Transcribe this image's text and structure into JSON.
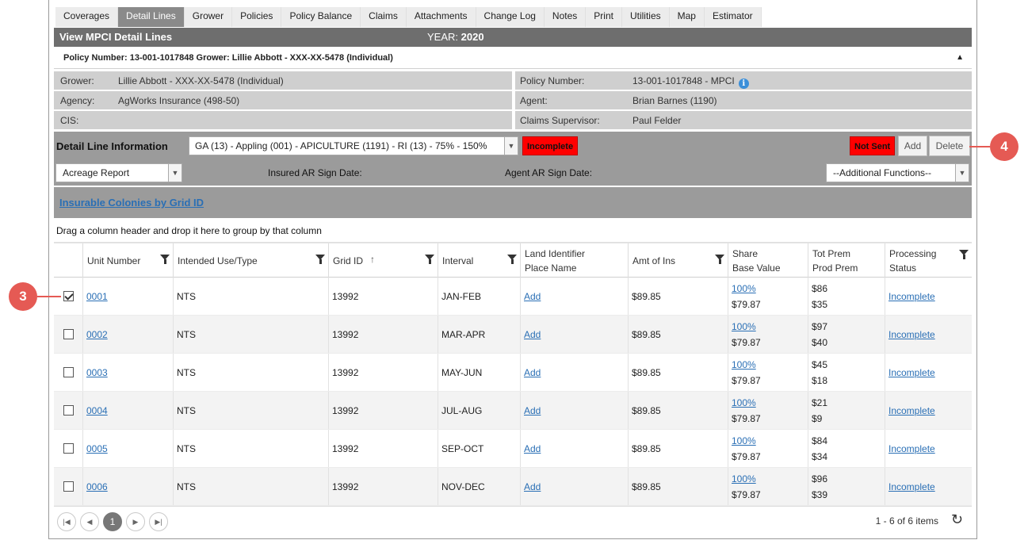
{
  "tabs": [
    {
      "label": "Coverages",
      "active": false
    },
    {
      "label": "Detail Lines",
      "active": true
    },
    {
      "label": "Grower",
      "active": false
    },
    {
      "label": "Policies",
      "active": false
    },
    {
      "label": "Policy Balance",
      "active": false
    },
    {
      "label": "Claims",
      "active": false
    },
    {
      "label": "Attachments",
      "active": false
    },
    {
      "label": "Change Log",
      "active": false
    },
    {
      "label": "Notes",
      "active": false
    },
    {
      "label": "Print",
      "active": false
    },
    {
      "label": "Utilities",
      "active": false
    },
    {
      "label": "Map",
      "active": false
    },
    {
      "label": "Estimator",
      "active": false
    }
  ],
  "title_bar": {
    "title": "View MPCI Detail Lines",
    "year_label": "YEAR:",
    "year": "2020"
  },
  "policy_header": {
    "text": "Policy Number: 13-001-1017848 Grower: Lillie Abbott - XXX-XX-5478 (Individual)",
    "collapse_glyph": "▲"
  },
  "info": {
    "grower_label": "Grower:",
    "grower": "Lillie Abbott - XXX-XX-5478 (Individual)",
    "agency_label": "Agency:",
    "agency": "AgWorks Insurance (498-50)",
    "cis_label": "CIS:",
    "cis": "",
    "policy_number_label": "Policy Number:",
    "policy_number": "13-001-1017848 - MPCI",
    "agent_label": "Agent:",
    "agent": "Brian Barnes (1190)",
    "claims_supervisor_label": "Claims Supervisor:",
    "claims_supervisor": "Paul Felder"
  },
  "detail_line": {
    "title": "Detail Line Information",
    "selected": "GA (13) - Appling (001) - APICULTURE (1191) - RI (13) - 75% - 150%",
    "status": "Incomplete",
    "send_status": "Not Sent",
    "add_label": "Add",
    "delete_label": "Delete",
    "report_type": "Acreage Report",
    "insured_sign_label": "Insured AR Sign Date:",
    "agent_sign_label": "Agent AR Sign Date:",
    "additional_functions": "--Additional Functions--"
  },
  "colonies_link": "Insurable Colonies by Grid ID",
  "group_hint": "Drag a column header and drop it here to group by that column",
  "columns": {
    "unit_number": "Unit Number",
    "intended_use": "Intended Use/Type",
    "grid_id": "Grid ID",
    "interval": "Interval",
    "land_id_1": "Land Identifier",
    "land_id_2": "Place Name",
    "amt_of_ins": "Amt of Ins",
    "share_1": "Share",
    "share_2": "Base Value",
    "prem_1": "Tot Prem",
    "prem_2": "Prod Prem",
    "status_1": "Processing",
    "status_2": "Status"
  },
  "rows": [
    {
      "checked": true,
      "unit": "0001",
      "use": "NTS",
      "grid": "13992",
      "interval": "JAN-FEB",
      "land": "Add",
      "amt": "$89.85",
      "share": "100%",
      "base": "$79.87",
      "tot_prem": "$86",
      "prod_prem": "$35",
      "status": "Incomplete"
    },
    {
      "checked": false,
      "unit": "0002",
      "use": "NTS",
      "grid": "13992",
      "interval": "MAR-APR",
      "land": "Add",
      "amt": "$89.85",
      "share": "100%",
      "base": "$79.87",
      "tot_prem": "$97",
      "prod_prem": "$40",
      "status": "Incomplete"
    },
    {
      "checked": false,
      "unit": "0003",
      "use": "NTS",
      "grid": "13992",
      "interval": "MAY-JUN",
      "land": "Add",
      "amt": "$89.85",
      "share": "100%",
      "base": "$79.87",
      "tot_prem": "$45",
      "prod_prem": "$18",
      "status": "Incomplete"
    },
    {
      "checked": false,
      "unit": "0004",
      "use": "NTS",
      "grid": "13992",
      "interval": "JUL-AUG",
      "land": "Add",
      "amt": "$89.85",
      "share": "100%",
      "base": "$79.87",
      "tot_prem": "$21",
      "prod_prem": "$9",
      "status": "Incomplete"
    },
    {
      "checked": false,
      "unit": "0005",
      "use": "NTS",
      "grid": "13992",
      "interval": "SEP-OCT",
      "land": "Add",
      "amt": "$89.85",
      "share": "100%",
      "base": "$79.87",
      "tot_prem": "$84",
      "prod_prem": "$34",
      "status": "Incomplete"
    },
    {
      "checked": false,
      "unit": "0006",
      "use": "NTS",
      "grid": "13992",
      "interval": "NOV-DEC",
      "land": "Add",
      "amt": "$89.85",
      "share": "100%",
      "base": "$79.87",
      "tot_prem": "$96",
      "prod_prem": "$39",
      "status": "Incomplete"
    }
  ],
  "pager": {
    "current_page": "1",
    "summary": "1 - 6 of 6 items"
  },
  "callouts": {
    "checkbox": "3",
    "delete": "4"
  },
  "colors": {
    "accent_red": "#ff0000",
    "callout": "#e55a54",
    "link": "#2a6fb5",
    "header_gray": "#6e6e6e"
  }
}
